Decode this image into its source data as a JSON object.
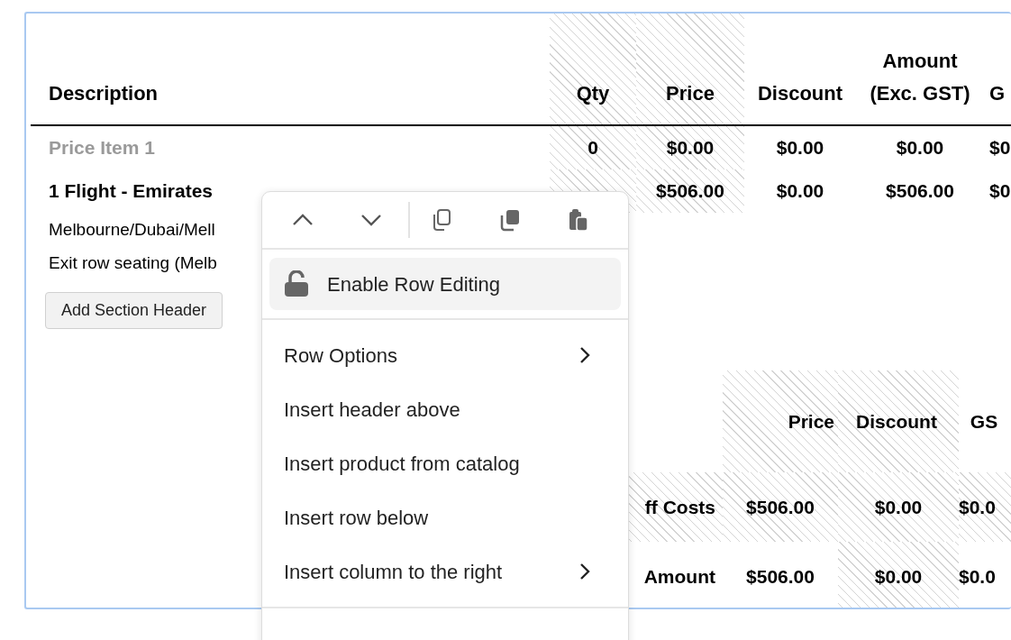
{
  "line_items": {
    "columns": [
      {
        "label": "Description",
        "hatched": false
      },
      {
        "label": "Qty",
        "hatched": true
      },
      {
        "label": "Price",
        "hatched": true
      },
      {
        "label": "Discount",
        "hatched": false
      },
      {
        "label": "Amount (Exc. GST)",
        "hatched": false
      },
      {
        "label": "G",
        "hatched": false
      }
    ],
    "rows": [
      {
        "muted": true,
        "cells": [
          {
            "text": "Price Item 1",
            "hatched": false
          },
          {
            "text": "0",
            "hatched": true
          },
          {
            "text": "$0.00",
            "hatched": true
          },
          {
            "text": "$0.00",
            "hatched": false
          },
          {
            "text": "$0.00",
            "hatched": false
          },
          {
            "text": "$0",
            "hatched": false
          }
        ]
      },
      {
        "muted": false,
        "cells": [
          {
            "text": "1 Flight - Emirates",
            "hatched": false
          },
          {
            "hatched": true
          },
          {
            "text": "$506.00",
            "hatched": true
          },
          {
            "text": "$0.00",
            "hatched": false
          },
          {
            "text": "$506.00",
            "hatched": false
          },
          {
            "text": "$0",
            "hatched": false
          }
        ]
      }
    ],
    "description_lines": [
      "Melbourne/Dubai/Mell",
      "Exit row seating (Melb"
    ],
    "buttons": [
      "Add Section Header"
    ]
  },
  "summary": {
    "columns": [
      {
        "label": "Price",
        "hatched": true
      },
      {
        "label": "Discount",
        "hatched": true
      },
      {
        "label": "GS",
        "hatched": false
      }
    ],
    "rows": [
      {
        "label": "ff Costs",
        "label_hatched": true,
        "cells": [
          {
            "text": "$506.00",
            "hatched": true
          },
          {
            "text": "$0.00",
            "hatched": true
          },
          {
            "text": "$0.0",
            "hatched": true
          }
        ]
      },
      {
        "label": "Amount",
        "label_hatched": false,
        "cells": [
          {
            "text": "$506.00",
            "hatched": false
          },
          {
            "text": "$0.00",
            "hatched": true
          },
          {
            "text": "$0.0",
            "hatched": false
          }
        ]
      }
    ]
  },
  "context_menu": {
    "groups": [
      [
        {
          "label": "Enable Row Editing",
          "kind": "lock",
          "submenu": false,
          "selected": true
        }
      ],
      [
        {
          "label": "Row Options",
          "kind": "plain",
          "submenu": true,
          "selected": false
        },
        {
          "label": "Insert header above",
          "kind": "plain",
          "submenu": false,
          "selected": false
        },
        {
          "label": "Insert product from catalog",
          "kind": "plain",
          "submenu": false,
          "selected": false
        },
        {
          "label": "Insert row below",
          "kind": "plain",
          "submenu": false,
          "selected": false
        },
        {
          "label": "Insert column to the right",
          "kind": "plain",
          "submenu": true,
          "selected": false
        }
      ]
    ]
  }
}
